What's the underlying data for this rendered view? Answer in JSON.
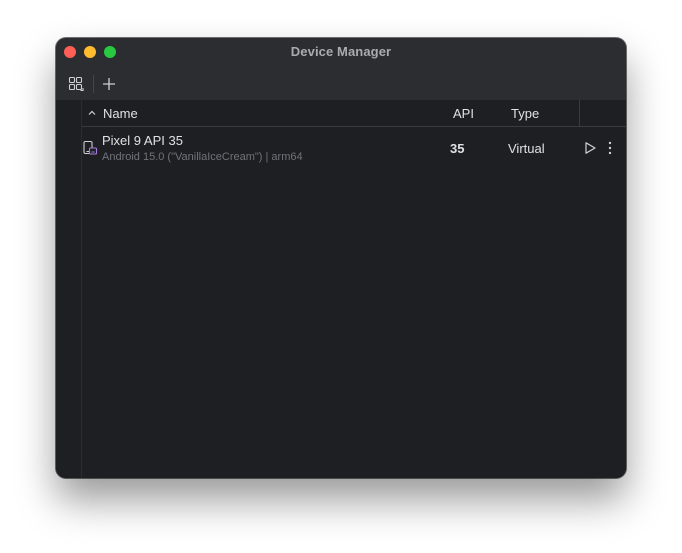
{
  "window": {
    "title": "Device Manager"
  },
  "toolbar": {
    "group_icon": "device-group-icon",
    "add_icon": "plus-icon"
  },
  "table": {
    "sort_icon": "chevron-up-icon",
    "columns": [
      "Name",
      "API",
      "Type"
    ],
    "rows": [
      {
        "icon": "phone-device-icon",
        "name": "Pixel 9 API 35",
        "subtitle": "Android 15.0 (\"VanillaIceCream\") | arm64",
        "api": "35",
        "type": "Virtual",
        "actions": [
          "play-icon",
          "more-vertical-icon"
        ]
      }
    ]
  },
  "colors": {
    "window_bg": "#2b2d30",
    "content_bg": "#1e1f22",
    "text": "#dfe1e5",
    "muted_text": "#6f737a",
    "device_icon_accent": "#a67ed9"
  }
}
